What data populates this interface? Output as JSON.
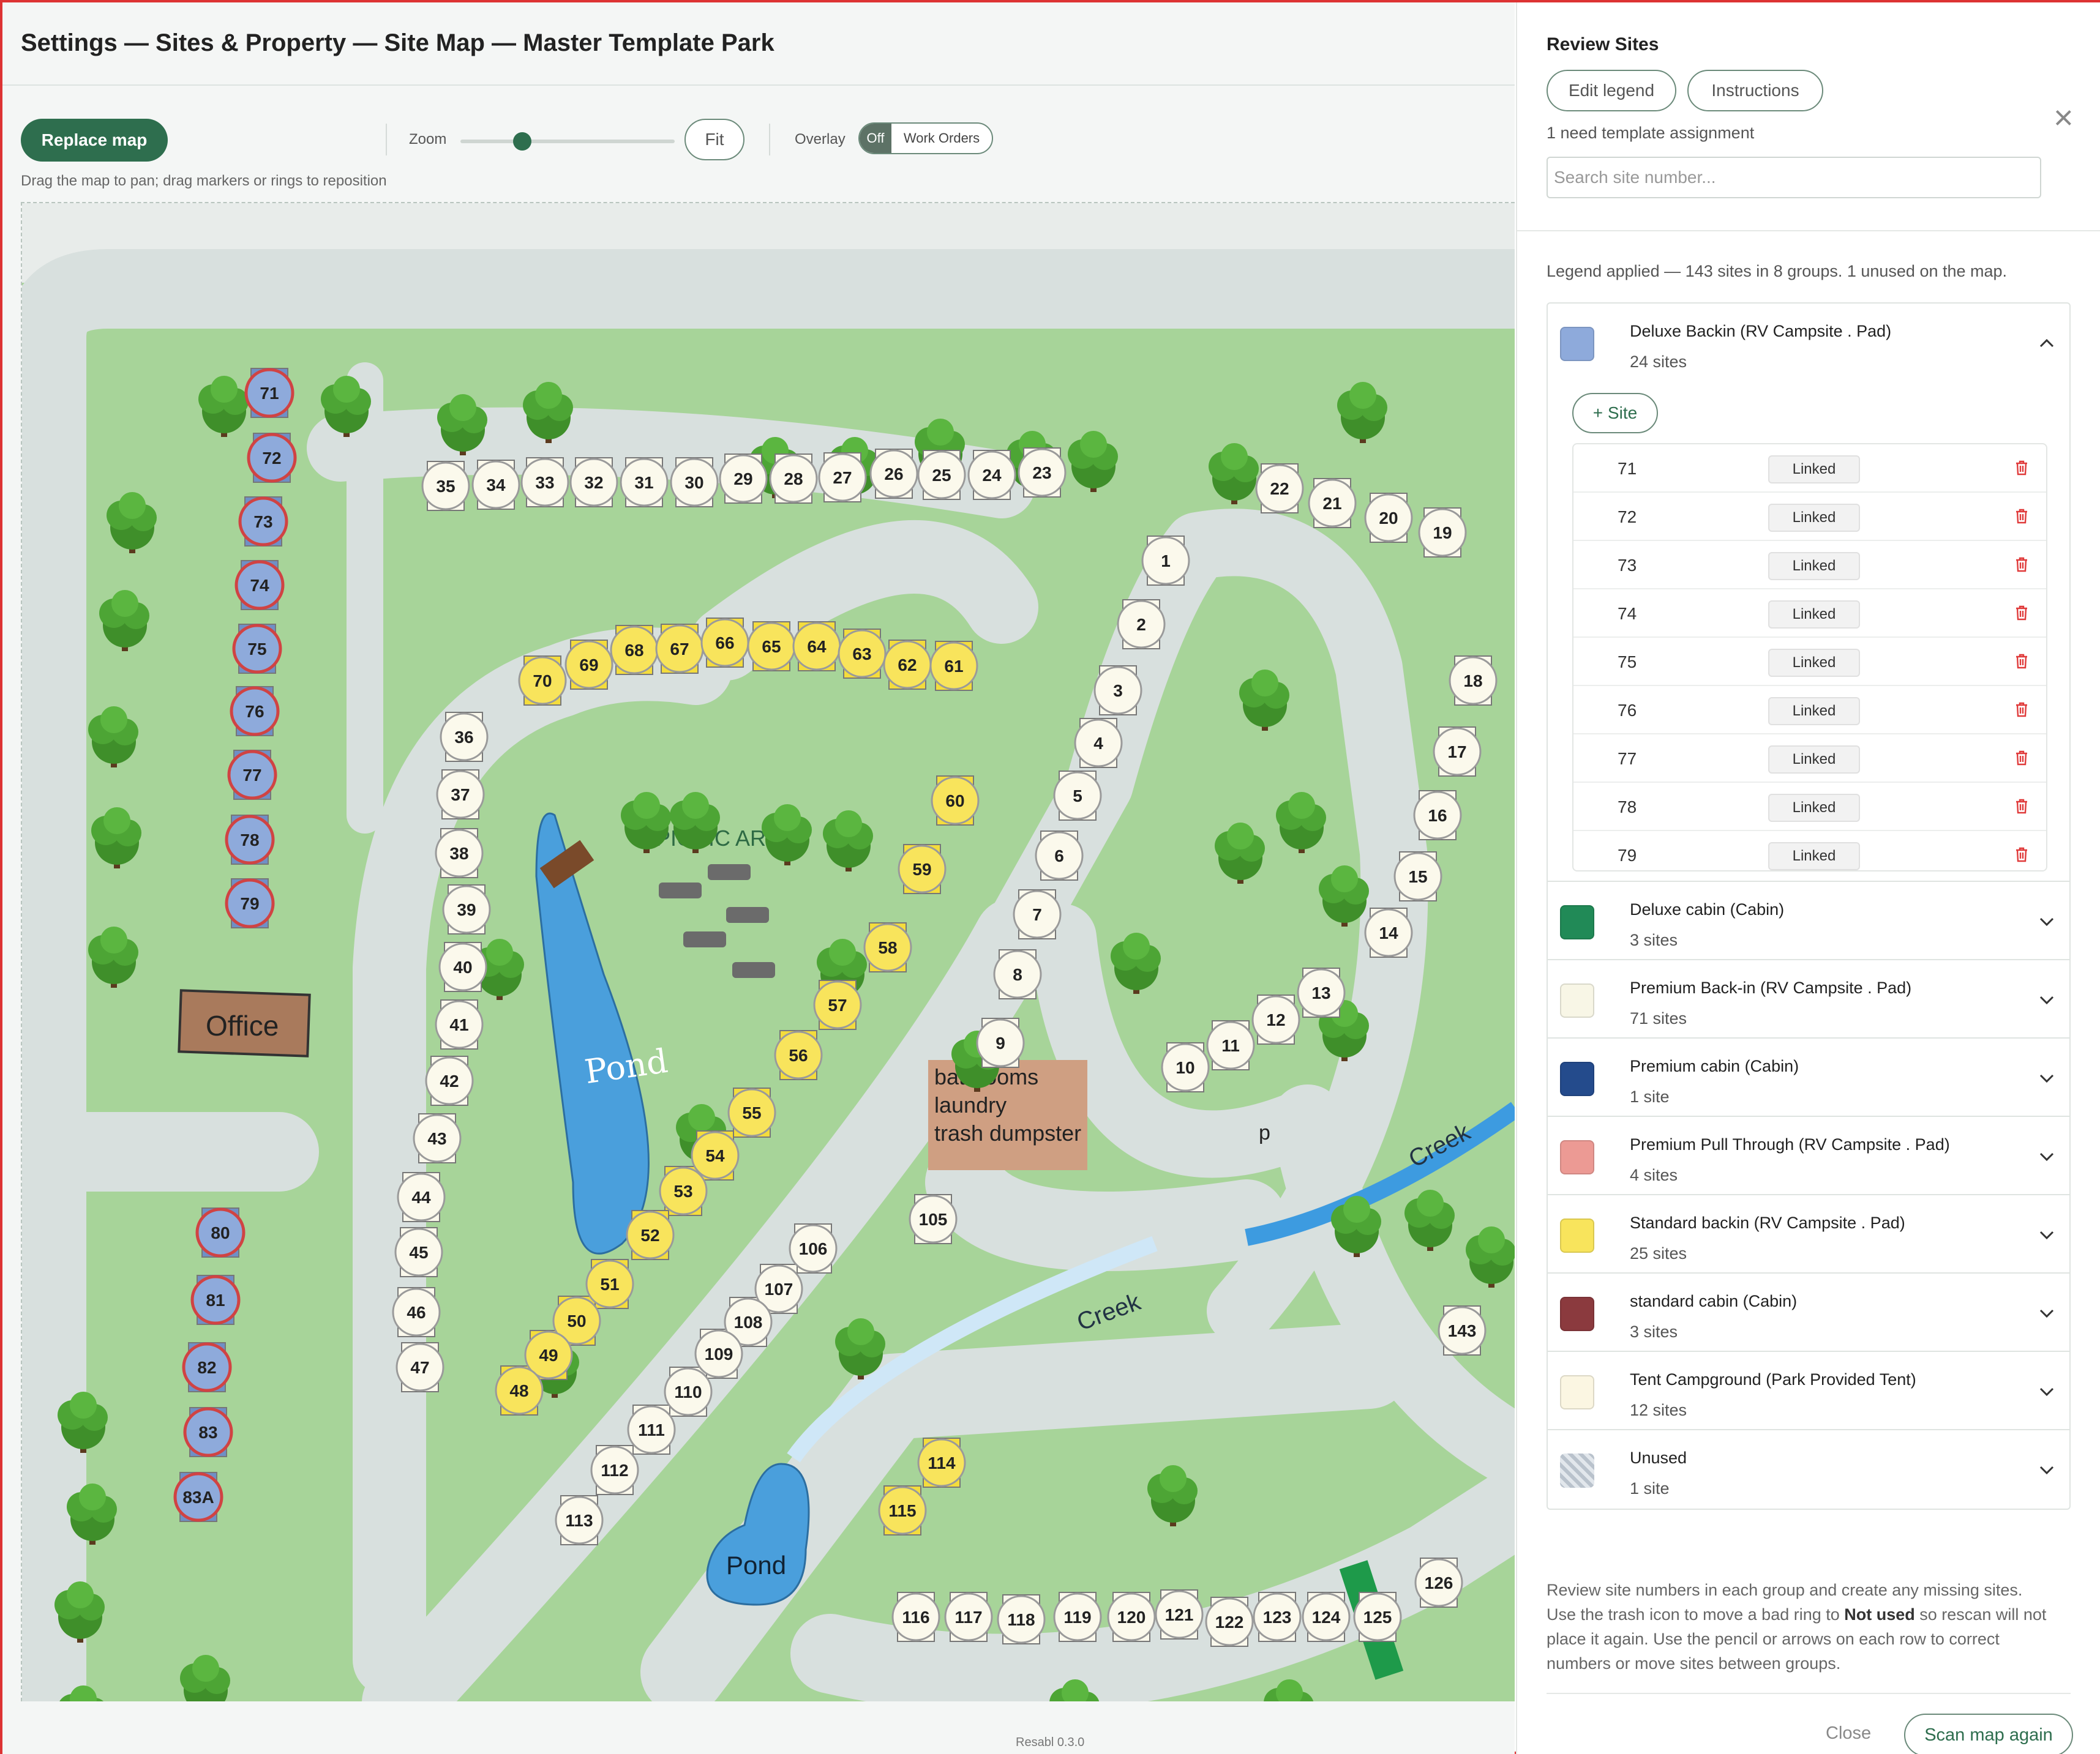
{
  "header": {
    "title": "Settings — Sites & Property — Site Map — Master Template Park"
  },
  "toolbar": {
    "replace_map": "Replace map",
    "zoom_label": "Zoom",
    "zoom_level": 0.3,
    "fit": "Fit",
    "overlay_label": "Overlay",
    "overlay_off": "Off",
    "overlay_work_orders": "Work Orders",
    "hint": "Drag the map to pan; drag markers or rings to reposition"
  },
  "map": {
    "labels": {
      "office": "Office",
      "picnic": "PICNIC AREA",
      "pond_main": "Pond",
      "pond_small": "Pond",
      "creek_1": "Creek",
      "creek_2": "Creek",
      "bathrooms": "bathrooms",
      "laundry": "laundry",
      "dumpster": "trash dumpster",
      "partial": "p"
    },
    "colors": {
      "blue": "#8eaadb",
      "yellow": "#f8e45c",
      "cream": "#fbf9ec",
      "ring_red": "#d04343"
    },
    "blue_sites": [
      "71",
      "72",
      "73",
      "74",
      "75",
      "76",
      "77",
      "78",
      "79",
      "80",
      "81",
      "82",
      "83",
      "83A"
    ],
    "yellow_sites": [
      "70",
      "69",
      "68",
      "67",
      "66",
      "65",
      "64",
      "63",
      "62",
      "61",
      "60",
      "59",
      "58",
      "57",
      "56",
      "55",
      "54",
      "53",
      "52",
      "51",
      "50",
      "49",
      "48",
      "114",
      "115"
    ],
    "cream_sites": [
      "35",
      "34",
      "33",
      "32",
      "31",
      "30",
      "29",
      "28",
      "27",
      "26",
      "25",
      "24",
      "23",
      "22",
      "21",
      "20",
      "19",
      "1",
      "2",
      "3",
      "4",
      "5",
      "6",
      "7",
      "8",
      "9",
      "10",
      "11",
      "12",
      "13",
      "14",
      "15",
      "16",
      "17",
      "18",
      "36",
      "37",
      "38",
      "39",
      "40",
      "41",
      "42",
      "43",
      "44",
      "45",
      "46",
      "47",
      "105",
      "106",
      "107",
      "108",
      "109",
      "110",
      "111",
      "112",
      "113",
      "116",
      "117",
      "118",
      "119",
      "120",
      "121",
      "122",
      "123",
      "124",
      "125",
      "126",
      "143"
    ]
  },
  "footer": {
    "version": "Resabl 0.3.0"
  },
  "panel": {
    "title": "Review Sites",
    "edit_legend": "Edit legend",
    "instructions": "Instructions",
    "close_icon": "×",
    "assignment_note": "1 need template assignment",
    "search_placeholder": "Search site number...",
    "legend_summary": "Legend applied — 143 sites in 8 groups. 1 unused on the map.",
    "add_site": "+ Site",
    "linked": "Linked",
    "expanded_rows": [
      "71",
      "72",
      "73",
      "74",
      "75",
      "76",
      "77",
      "78",
      "79"
    ],
    "groups": [
      {
        "name": "Deluxe Backin (RV Campsite . Pad)",
        "count": "24 sites",
        "color": "#8eaadb"
      },
      {
        "name": "Deluxe cabin (Cabin)",
        "count": "3 sites",
        "color": "#218a57"
      },
      {
        "name": "Premium Back-in (RV Campsite . Pad)",
        "count": "71 sites",
        "color": "#f8f6e6"
      },
      {
        "name": "Premium cabin (Cabin)",
        "count": "1 site",
        "color": "#244b8c"
      },
      {
        "name": "Premium Pull Through (RV Campsite . Pad)",
        "count": "4 sites",
        "color": "#ec9a94"
      },
      {
        "name": "Standard backin (RV Campsite . Pad)",
        "count": "25 sites",
        "color": "#f8e45c"
      },
      {
        "name": "standard cabin (Cabin)",
        "count": "3 sites",
        "color": "#8b3a3e"
      },
      {
        "name": "Tent Campground (Park Provided Tent)",
        "count": "12 sites",
        "color": "#fbf6e2"
      },
      {
        "name": "Unused",
        "count": "1 site",
        "color": "#c0c7cf"
      }
    ],
    "help_before": "Review site numbers in each group and create any missing sites. Use the trash icon to move a bad ring to ",
    "help_bold": "Not used",
    "help_after": " so rescan will not place it again. Use the pencil or arrows on each row to correct numbers or move sites between groups.",
    "close": "Close",
    "scan_again": "Scan map again"
  }
}
